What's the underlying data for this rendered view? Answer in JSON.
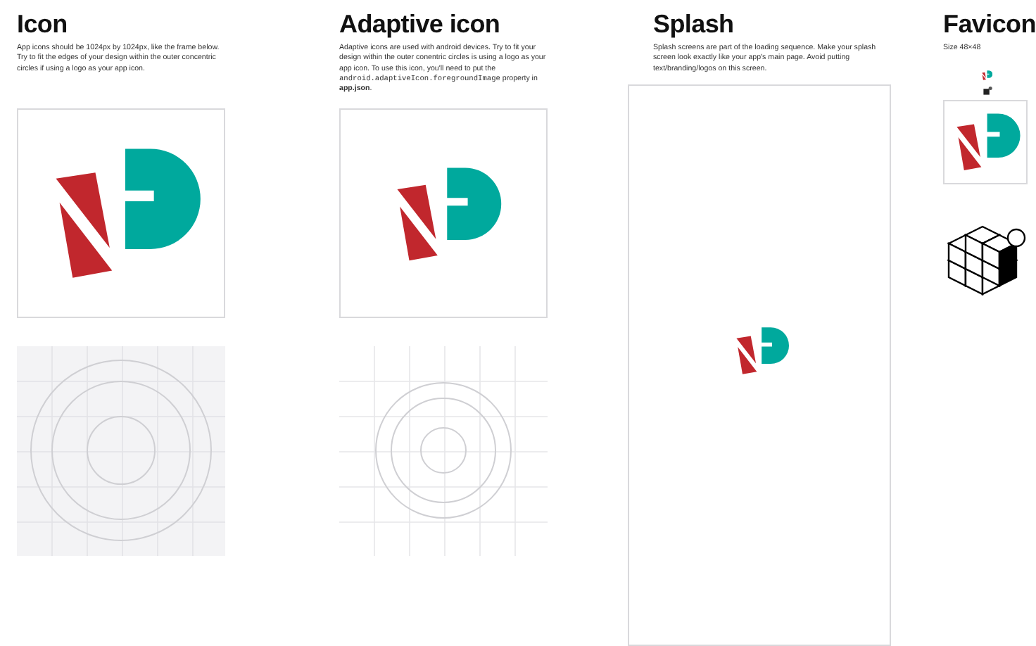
{
  "sections": [
    {
      "kind": "icon",
      "title": "Icon",
      "description": [
        {
          "kind": "text",
          "text": "App icons should be 1024px by 1024px, like the frame below. Try to fit the edges of your design within the outer concentric circles if using a logo as your app icon."
        }
      ]
    },
    {
      "kind": "adaptive",
      "title": "Adaptive icon",
      "description": [
        {
          "kind": "text",
          "text": "Adaptive icons are used with android devices. Try to fit your design within the outer conentric circles is using a logo as your app icon. To use this icon, you'll need to put the "
        },
        {
          "kind": "code",
          "text": "android.adaptiveIcon.foregroundImage"
        },
        {
          "kind": "text",
          "text": " property in **app.json**."
        }
      ]
    },
    {
      "kind": "splash",
      "title": "Splash",
      "description": [
        {
          "kind": "text",
          "text": "Splash screens are part of the loading sequence. Make your splash screen look exactly like your app's main page. Avoid putting text/branding/logos on this screen."
        }
      ]
    },
    {
      "kind": "favicon",
      "title": "Favicon",
      "description": [
        {
          "kind": "text",
          "text": "Size 48×48"
        }
      ]
    }
  ]
}
